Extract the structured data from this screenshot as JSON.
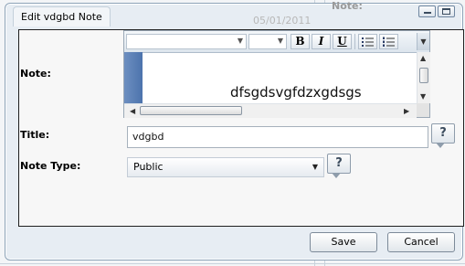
{
  "background": {
    "date": "05/01/2011",
    "section_label": "Note:"
  },
  "dialog": {
    "title": "Edit vdgbd Note"
  },
  "editor": {
    "label": "Note:",
    "content": "dfsgdsvgfdzxgdsgs",
    "toolbar": {
      "bold_label": "B",
      "italic_label": "I",
      "underline_label": "U"
    }
  },
  "title_field": {
    "label": "Title:",
    "value": "vdgbd"
  },
  "note_type": {
    "label": "Note Type:",
    "selected": "Public"
  },
  "help": {
    "label": "?"
  },
  "buttons": {
    "save": "Save",
    "cancel": "Cancel"
  },
  "colors": {
    "dialog_bg": "#e7edf3",
    "panel_bg": "#f7f7f7",
    "editor_gutter": "#5a7fb7"
  }
}
